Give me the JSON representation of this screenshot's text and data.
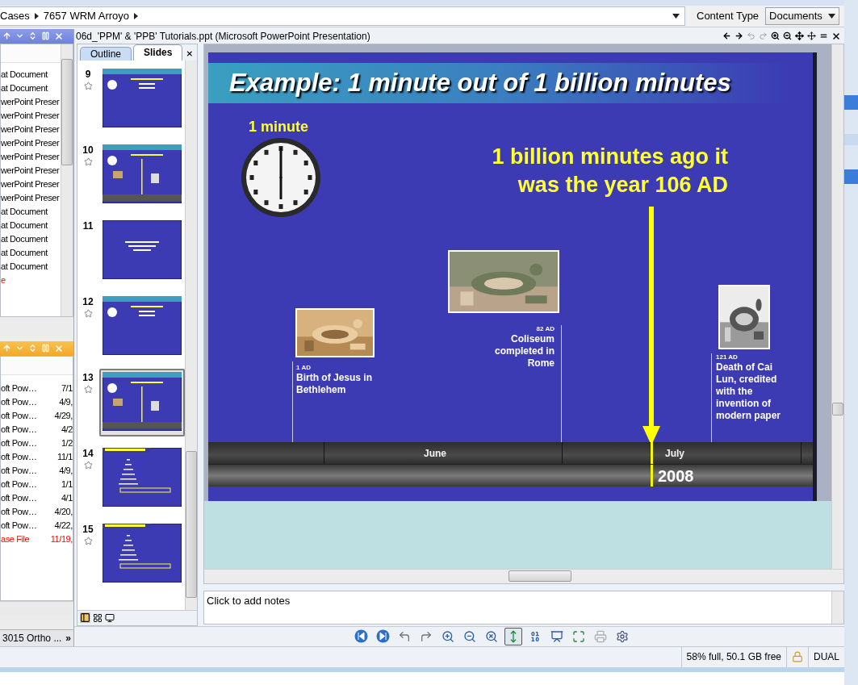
{
  "breadcrumb": [
    "Cases",
    "7657 WRM Arroyo"
  ],
  "content_type": {
    "label": "Content Type",
    "value": "Documents"
  },
  "document_title": "06d_'PPM' & 'PPB' Tutorials.ppt (Microsoft PowerPoint Presentation)",
  "top_list": [
    {
      "text": "at Document",
      "flagged": false
    },
    {
      "text": "at Document",
      "flagged": false
    },
    {
      "text": "werPoint Preser",
      "flagged": false
    },
    {
      "text": "werPoint Preser",
      "flagged": false
    },
    {
      "text": "werPoint Preser",
      "flagged": false
    },
    {
      "text": "werPoint Preser",
      "flagged": false
    },
    {
      "text": "werPoint Preser",
      "flagged": false
    },
    {
      "text": "werPoint Preser",
      "flagged": false
    },
    {
      "text": "werPoint Preser",
      "flagged": false
    },
    {
      "text": "werPoint Preser",
      "flagged": false
    },
    {
      "text": "at Document",
      "flagged": false
    },
    {
      "text": "at Document",
      "flagged": false
    },
    {
      "text": "at Document",
      "flagged": false
    },
    {
      "text": "at Document",
      "flagged": false
    },
    {
      "text": "at Document",
      "flagged": false
    },
    {
      "text": "e",
      "flagged": true
    }
  ],
  "bottom_list": [
    {
      "type": "oft Pow…",
      "date": "7/1",
      "flagged": false
    },
    {
      "type": "oft Pow…",
      "date": "4/9,",
      "flagged": false
    },
    {
      "type": "oft Pow…",
      "date": "4/29,",
      "flagged": false
    },
    {
      "type": "oft Pow…",
      "date": "4/2",
      "flagged": false
    },
    {
      "type": "oft Pow…",
      "date": "1/2",
      "flagged": false
    },
    {
      "type": "oft Pow…",
      "date": "11/1",
      "flagged": false
    },
    {
      "type": "oft Pow…",
      "date": "4/9,",
      "flagged": false
    },
    {
      "type": "oft Pow…",
      "date": "1/1",
      "flagged": false
    },
    {
      "type": "oft Pow…",
      "date": "4/1",
      "flagged": false
    },
    {
      "type": "oft Pow…",
      "date": "4/20,",
      "flagged": false
    },
    {
      "type": "oft Pow…",
      "date": "4/22,",
      "flagged": false
    },
    {
      "type": "ase File",
      "date": "11/19,",
      "flagged": true
    }
  ],
  "bottom_tab": {
    "label": "3015 Ortho ...",
    "more": "»"
  },
  "slide_tabs": [
    {
      "label": "Outline",
      "selected": false
    },
    {
      "label": "Slides",
      "selected": true
    }
  ],
  "slides": [
    {
      "number": "9",
      "kind": "clock",
      "starred": true,
      "selected": false
    },
    {
      "number": "10",
      "kind": "timeline",
      "starred": true,
      "selected": false
    },
    {
      "number": "11",
      "kind": "centered",
      "starred": false,
      "selected": false
    },
    {
      "number": "12",
      "kind": "clock",
      "starred": true,
      "selected": false
    },
    {
      "number": "13",
      "kind": "timeline",
      "starred": true,
      "selected": true
    },
    {
      "number": "14",
      "kind": "list",
      "starred": true,
      "selected": false
    },
    {
      "number": "15",
      "kind": "list",
      "starred": true,
      "selected": false
    }
  ],
  "slide": {
    "title": "Example: 1 minute out of 1 billion minutes",
    "clock_label": "1 minute",
    "caption": [
      "1 billion minutes ago it",
      "was the year 106 AD"
    ],
    "events": [
      {
        "date": "1 AD",
        "text": "Birth of Jesus in Bethlehem"
      },
      {
        "date": "82 AD",
        "text": "Coliseum completed in Rome"
      },
      {
        "date": "121 AD",
        "text": "Death of Cai Lun, credited with the invention of modern paper"
      }
    ],
    "months": [
      "June",
      "July"
    ],
    "year": "2008"
  },
  "notes_prompt": "Click to add notes",
  "toolbar": [
    {
      "kind": "first",
      "selected": false,
      "disabled": false
    },
    {
      "kind": "next",
      "selected": false,
      "disabled": false
    },
    {
      "kind": "back",
      "selected": false,
      "disabled": false
    },
    {
      "kind": "forward",
      "selected": false,
      "disabled": false
    },
    {
      "kind": "zoom-in",
      "selected": false,
      "disabled": false
    },
    {
      "kind": "zoom-out",
      "selected": false,
      "disabled": false
    },
    {
      "kind": "zoom-reset",
      "selected": false,
      "disabled": false
    },
    {
      "kind": "fit",
      "selected": true,
      "disabled": false
    },
    {
      "kind": "binary",
      "selected": false,
      "disabled": false
    },
    {
      "kind": "present",
      "selected": false,
      "disabled": false
    },
    {
      "kind": "fullscreen",
      "selected": false,
      "disabled": false
    },
    {
      "kind": "print",
      "selected": false,
      "disabled": true
    },
    {
      "kind": "settings",
      "selected": false,
      "disabled": false
    }
  ],
  "status": {
    "disk": "58% full, 50.1 GB free",
    "mode": "DUAL"
  }
}
